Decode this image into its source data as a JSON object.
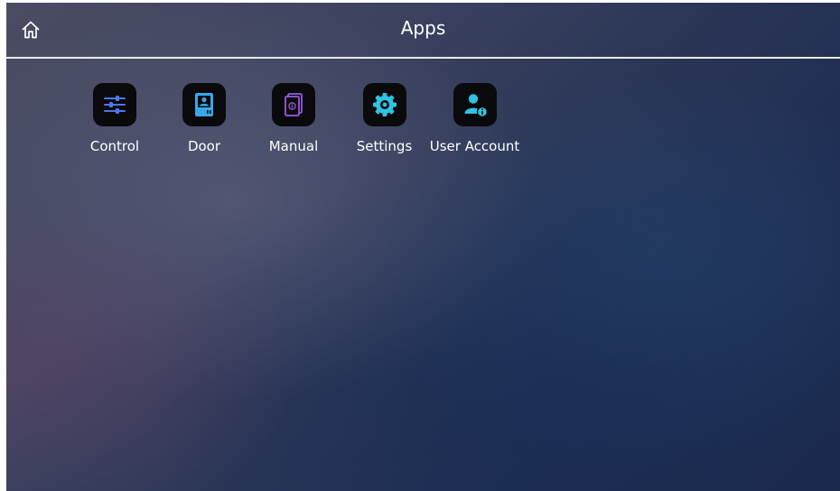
{
  "header": {
    "title": "Apps",
    "home_icon": "home-icon"
  },
  "apps": [
    {
      "label": "Control",
      "icon": "sliders-icon",
      "color": "#4a78ee"
    },
    {
      "label": "Door",
      "icon": "door-intercom-icon",
      "color": "#38a8ea"
    },
    {
      "label": "Manual",
      "icon": "manual-book-icon",
      "color": "#9b58e6"
    },
    {
      "label": "Settings",
      "icon": "gear-icon",
      "color": "#2fc3e3"
    },
    {
      "label": "User Account",
      "icon": "user-account-icon",
      "color": "#2fc3e3"
    }
  ]
}
